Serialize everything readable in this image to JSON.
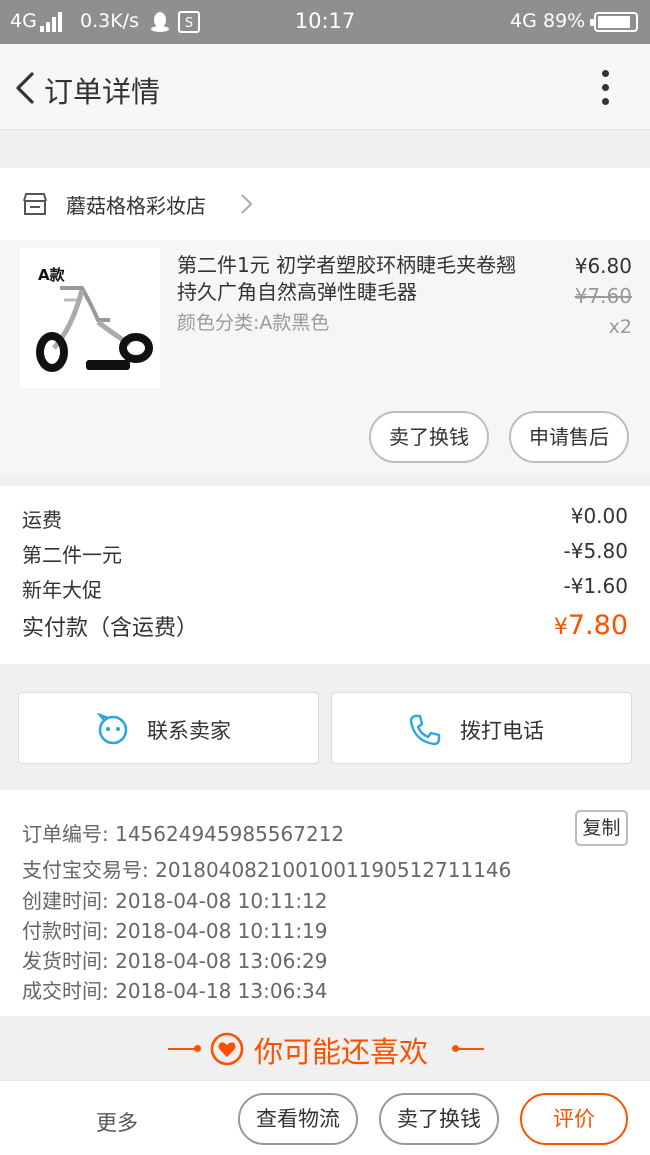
{
  "status_bar": {
    "network_left": "4G",
    "speed": "0.3K/s",
    "time": "10:17",
    "network_right": "4G",
    "battery_percent": "89%",
    "battery_level": 0.89
  },
  "nav": {
    "title": "订单详情"
  },
  "shop": {
    "name": "蘑菇格格彩妆店"
  },
  "item": {
    "thumb_tag": "A款",
    "title": "第二件1元 初学者塑胶环柄睫毛夹卷翘持久广角自然高弹性睫毛器",
    "spec": "颜色分类:A款黑色",
    "price_now": "¥6.80",
    "price_old": "¥7.60",
    "qty": "x2",
    "sell_label": "卖了换钱",
    "aftersale_label": "申请售后"
  },
  "fees": {
    "shipping_label": "运费",
    "shipping_value": "¥0.00",
    "promo1_label": "第二件一元",
    "promo1_value": "-¥5.80",
    "promo2_label": "新年大促",
    "promo2_value": "-¥1.60",
    "total_label": "实付款（含运费）",
    "total_currency": "¥",
    "total_value": "7.80"
  },
  "actions": {
    "contact_label": "联系卖家",
    "call_label": "拨打电话"
  },
  "order_info": {
    "order_no": "订单编号: 1456249459855672​12",
    "copy_label": "复制",
    "alipay_no": "支付宝交易号: 2018040821001001190512711146",
    "created": "创建时间: 2018-04-08 10:11:12",
    "paid": "付款时间: 2018-04-08 10:11:19",
    "shipped": "发货时间: 2018-04-08 13:06:29",
    "completed": "成交时间: 2018-04-18 13:06:34"
  },
  "recommend": {
    "title": "你可能还喜欢"
  },
  "bottom_bar": {
    "more_label": "更多",
    "logistics_label": "查看物流",
    "sell_label": "卖了换钱",
    "review_label": "评价"
  },
  "colors": {
    "accent": "#ff5000",
    "blue_icon": "#2aa6e0",
    "status_bar": "#8f8f8f"
  },
  "icons": [
    "back-arrow-icon",
    "more-vertical-icon",
    "store-icon",
    "chevron-right-icon",
    "chat-face-icon",
    "phone-icon",
    "heart-icon"
  ]
}
